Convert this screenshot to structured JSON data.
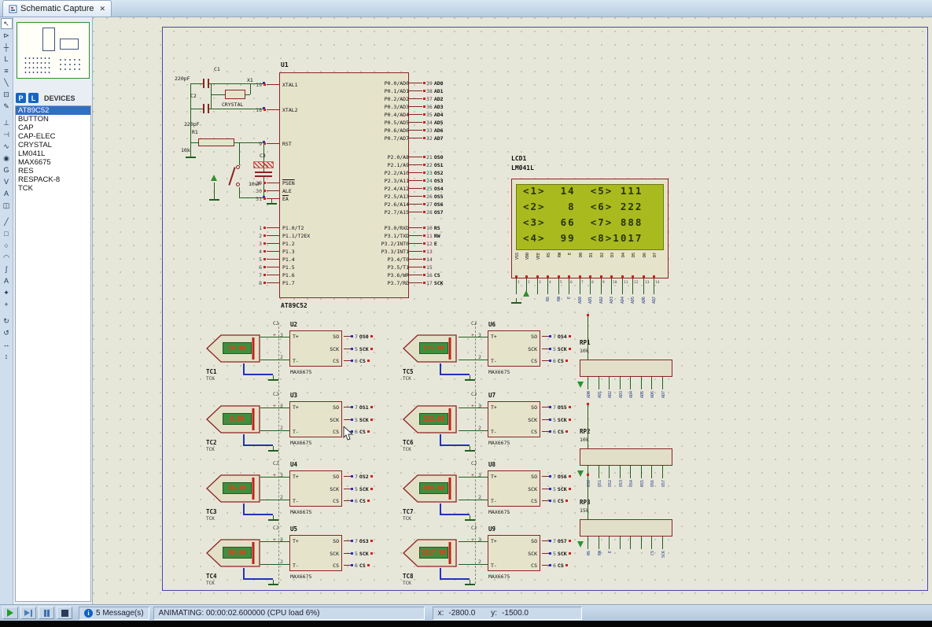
{
  "window": {
    "tab_title": "Schematic Capture",
    "close_glyph": "✕"
  },
  "left_toolbar": {
    "icons": [
      {
        "name": "selection-mode",
        "glyph": "↖"
      },
      {
        "name": "component-mode",
        "glyph": "⊳"
      },
      {
        "name": "junction-dot-mode",
        "glyph": "┼"
      },
      {
        "name": "wire-label-mode",
        "glyph": "L"
      },
      {
        "name": "text-script-mode",
        "glyph": "≡"
      },
      {
        "name": "buses-mode",
        "glyph": "╲"
      },
      {
        "name": "subcircuit-mode",
        "glyph": "⊡"
      },
      {
        "name": "instant-edit-mode",
        "glyph": "✎"
      },
      {
        "name": "terminals-mode",
        "glyph": "⊥"
      },
      {
        "name": "device-pins-mode",
        "glyph": "⊣"
      },
      {
        "name": "graph-mode",
        "glyph": "∿"
      },
      {
        "name": "tape-recorder-mode",
        "glyph": "◉"
      },
      {
        "name": "generator-mode",
        "glyph": "G"
      },
      {
        "name": "voltage-probe-mode",
        "glyph": "V"
      },
      {
        "name": "current-probe-mode",
        "glyph": "A"
      },
      {
        "name": "virtual-instruments-mode",
        "glyph": "◫"
      },
      {
        "name": "2d-line-mode",
        "glyph": "╱"
      },
      {
        "name": "2d-box-mode",
        "glyph": "□"
      },
      {
        "name": "2d-circle-mode",
        "glyph": "○"
      },
      {
        "name": "2d-arc-mode",
        "glyph": "◠"
      },
      {
        "name": "2d-path-mode",
        "glyph": "ʃ"
      },
      {
        "name": "2d-text-mode",
        "glyph": "A"
      },
      {
        "name": "2d-symbol-mode",
        "glyph": "✦"
      },
      {
        "name": "markers-mode",
        "glyph": "+"
      },
      {
        "name": "rotate-clockwise",
        "glyph": "↻"
      },
      {
        "name": "rotate-anticlockwise",
        "glyph": "↺"
      },
      {
        "name": "x-mirror",
        "glyph": "↔"
      },
      {
        "name": "y-mirror",
        "glyph": "↕"
      }
    ]
  },
  "devices_panel": {
    "pick_button": "P",
    "library_button": "L",
    "header": "DEVICES",
    "items": [
      "AT89C52",
      "BUTTON",
      "CAP",
      "CAP-ELEC",
      "CRYSTAL",
      "LM041L",
      "MAX6675",
      "RES",
      "RESPACK-8",
      "TCK"
    ]
  },
  "schematic": {
    "u1": {
      "ref": "U1",
      "part": "AT89C52",
      "left_pins": [
        {
          "num": "19",
          "name": "XTAL1"
        },
        {
          "num": "18",
          "name": "XTAL2"
        },
        {
          "num": "9",
          "name": "RST"
        },
        {
          "num": "29",
          "name": "PSEN"
        },
        {
          "num": "30",
          "name": "ALE"
        },
        {
          "num": "31",
          "name": "EA"
        },
        {
          "num": "1",
          "name": "P1.0/T2"
        },
        {
          "num": "2",
          "name": "P1.1/T2EX"
        },
        {
          "num": "3",
          "name": "P1.2"
        },
        {
          "num": "4",
          "name": "P1.3"
        },
        {
          "num": "5",
          "name": "P1.4"
        },
        {
          "num": "6",
          "name": "P1.5"
        },
        {
          "num": "7",
          "name": "P1.6"
        },
        {
          "num": "8",
          "name": "P1.7"
        }
      ],
      "right_pins": [
        {
          "name": "P0.0/AD0",
          "num": "39",
          "net": "AD0"
        },
        {
          "name": "P0.1/AD1",
          "num": "38",
          "net": "AD1"
        },
        {
          "name": "P0.2/AD2",
          "num": "37",
          "net": "AD2"
        },
        {
          "name": "P0.3/AD3",
          "num": "36",
          "net": "AD3"
        },
        {
          "name": "P0.4/AD4",
          "num": "35",
          "net": "AD4"
        },
        {
          "name": "P0.5/AD5",
          "num": "34",
          "net": "AD5"
        },
        {
          "name": "P0.6/AD6",
          "num": "33",
          "net": "AD6"
        },
        {
          "name": "P0.7/AD7",
          "num": "32",
          "net": "AD7"
        },
        {
          "name": "P2.0/A8",
          "num": "21",
          "net": "OS0"
        },
        {
          "name": "P2.1/A9",
          "num": "22",
          "net": "OS1"
        },
        {
          "name": "P2.2/A10",
          "num": "23",
          "net": "OS2"
        },
        {
          "name": "P2.3/A11",
          "num": "24",
          "net": "OS3"
        },
        {
          "name": "P2.4/A12",
          "num": "25",
          "net": "OS4"
        },
        {
          "name": "P2.5/A13",
          "num": "26",
          "net": "OS5"
        },
        {
          "name": "P2.6/A14",
          "num": "27",
          "net": "OS6"
        },
        {
          "name": "P2.7/A15",
          "num": "28",
          "net": "OS7"
        },
        {
          "name": "P3.0/RXD",
          "num": "10",
          "net": "RS"
        },
        {
          "name": "P3.1/TXD",
          "num": "11",
          "net": "RW"
        },
        {
          "name": "P3.2/INT0",
          "num": "12",
          "net": "E"
        },
        {
          "name": "P3.3/INT1",
          "num": "13",
          "net": ""
        },
        {
          "name": "P3.4/T0",
          "num": "14",
          "net": ""
        },
        {
          "name": "P3.5/T1",
          "num": "15",
          "net": ""
        },
        {
          "name": "P3.6/WR",
          "num": "16",
          "net": "CS"
        },
        {
          "name": "P3.7/RD",
          "num": "17",
          "net": "SCK"
        }
      ]
    },
    "passives": {
      "c1": {
        "ref": "C1",
        "value": "220pF"
      },
      "c2": {
        "ref": "C2",
        "value": "220pF"
      },
      "c3": {
        "ref": "C3",
        "value": "10uF"
      },
      "r1": {
        "ref": "R1",
        "value": "10k"
      },
      "x1": {
        "ref": "X1",
        "value": "CRYSTAL"
      }
    },
    "lcd": {
      "ref": "LCD1",
      "part": "LM041L",
      "lines": [
        "<1>  14  <5> 111",
        "<2>   8  <6> 222",
        "<3>  66  <7> 888",
        "<4>  99  <8>1017"
      ],
      "pins": [
        "VSS",
        "VDD",
        "VEE",
        "RS",
        "RW",
        "E",
        "D0",
        "D1",
        "D2",
        "D3",
        "D4",
        "D5",
        "D6",
        "D7"
      ],
      "pin_numbers": [
        "1",
        "2",
        "3",
        "4",
        "5",
        "6",
        "7",
        "8",
        "9",
        "10",
        "11",
        "12",
        "13",
        "14"
      ],
      "stub_nets": [
        "",
        "",
        "",
        "RS",
        "RW",
        "E",
        "AD0",
        "AD1",
        "AD2",
        "AD3",
        "AD4",
        "AD5",
        "AD6",
        "AD7"
      ]
    },
    "max_pin_labels": {
      "cj": "CJ",
      "plus": "+",
      "tplus": "T+",
      "tminus": "T-",
      "so": "SO",
      "sck": "SCK",
      "cs": "CS",
      "pin_tplus": "3",
      "pin_tminus": "2",
      "pin_so": "7",
      "pin_sck": "5",
      "pin_cs": "6",
      "sck_net": "SCK",
      "cs_net": "CS"
    },
    "max_modules": [
      {
        "ref": "U2",
        "part": "MAX6675",
        "so_net": "OS0"
      },
      {
        "ref": "U3",
        "part": "MAX6675",
        "so_net": "OS1"
      },
      {
        "ref": "U4",
        "part": "MAX6675",
        "so_net": "OS2"
      },
      {
        "ref": "U5",
        "part": "MAX6675",
        "so_net": "OS3"
      },
      {
        "ref": "U6",
        "part": "MAX6675",
        "so_net": "OS4"
      },
      {
        "ref": "U7",
        "part": "MAX6675",
        "so_net": "OS5"
      },
      {
        "ref": "U8",
        "part": "MAX6675",
        "so_net": "OS6"
      },
      {
        "ref": "U9",
        "part": "MAX6675",
        "so_net": "OS7"
      }
    ],
    "thermocouples": [
      {
        "ref": "TC1",
        "part": "TCK",
        "reading": "14.00"
      },
      {
        "ref": "TC2",
        "part": "TCK",
        "reading": "8.00"
      },
      {
        "ref": "TC3",
        "part": "TCK",
        "reading": "66.00"
      },
      {
        "ref": "TC4",
        "part": "TCK",
        "reading": "99.00"
      },
      {
        "ref": "TC5",
        "part": "TCK",
        "reading": "111.00"
      },
      {
        "ref": "TC6",
        "part": "TCK",
        "reading": "222.00"
      },
      {
        "ref": "TC7",
        "part": "TCK",
        "reading": "888.00"
      },
      {
        "ref": "TC8",
        "part": "TCK",
        "reading": "1017.00"
      }
    ],
    "resistor_packs": [
      {
        "ref": "RP1",
        "value": "10k",
        "pin_nets": [
          "AD0",
          "AD1",
          "AD2",
          "AD3",
          "AD4",
          "AD5",
          "AD6",
          "AD7"
        ]
      },
      {
        "ref": "RP2",
        "value": "10k",
        "pin_nets": [
          "OS0",
          "OS1",
          "OS2",
          "OS3",
          "OS4",
          "OS5",
          "OS6",
          "OS7"
        ]
      },
      {
        "ref": "RP3",
        "value": "15k",
        "pin_nets": [
          "RS",
          "RW",
          "E",
          "",
          "",
          "",
          "CS",
          "SCK"
        ]
      }
    ]
  },
  "status_bar": {
    "messages": "5 Message(s)",
    "status": "ANIMATING: 00:00:02.600000 (CPU load 6%)",
    "x_label": "x:",
    "x_value": "-2800.0",
    "y_label": "y:",
    "y_value": "-1500.0"
  },
  "colors": {
    "selection": "#2F6FC4",
    "component_outline": "#8B2323",
    "wire_green": "#215E21",
    "wire_blue": "#2233BB",
    "lcd_screen": "#A9BA1E",
    "display_bg": "#3F8F3F",
    "display_text": "#FF3014"
  }
}
